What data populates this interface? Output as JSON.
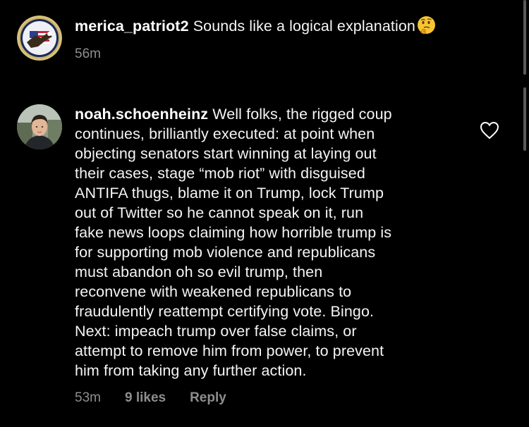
{
  "comments": [
    {
      "username": "merica_patriot2",
      "text": "Sounds like a logical explanation",
      "emoji": "thinking-face-emoji",
      "time": "56m"
    },
    {
      "username": "noah.schoenheinz",
      "text_lines": [
        "Well folks, the rigged coup",
        "continues, brilliantly executed: at point when",
        "objecting senators start winning at laying out",
        "their cases, stage “mob riot” with disguised",
        "ANTIFA thugs, blame it on Trump, lock Trump",
        "out of Twitter so he cannot speak on it, run",
        "fake news loops claiming how horrible trump is",
        "for supporting mob violence and republicans",
        "must abandon oh so evil trump, then",
        "reconvene with weakened republicans to",
        "fraudulently reattempt certifying vote. Bingo.",
        "Next: impeach trump over false claims, or",
        "attempt to remove him from power, to prevent",
        "him from taking any further action."
      ],
      "time": "53m",
      "likes": "9 likes",
      "reply_label": "Reply",
      "like_icon": "heart-outline-icon"
    }
  ],
  "colors": {
    "background": "#000000",
    "text": "#ffffff",
    "meta": "#8e8e8e",
    "scrollbar": "#5a5a5a"
  }
}
